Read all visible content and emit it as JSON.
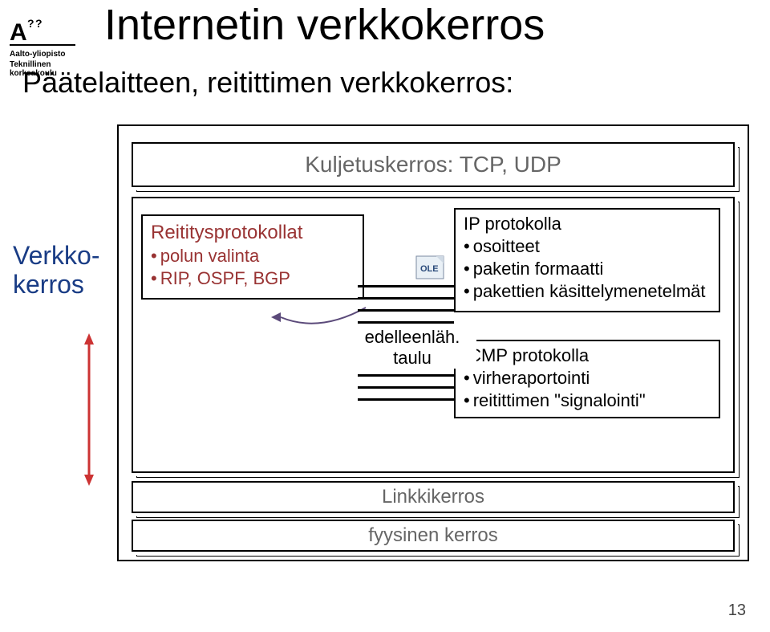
{
  "logo": {
    "line1": "Aalto-yliopisto",
    "line2": "Teknillinen korkeakoulu"
  },
  "title": "Internetin verkkokerros",
  "subtitle": "Päätelaitteen, reitittimen verkkokerros:",
  "sideLabel": {
    "line1": "Verkko-",
    "line2": "kerros"
  },
  "transport": "Kuljetuskerros: TCP, UDP",
  "routing": {
    "title": "Reititysprotokollat",
    "lines": [
      "polun valinta",
      "RIP, OSPF, BGP"
    ]
  },
  "ip": {
    "title": "IP protokolla",
    "lines": [
      "osoitteet",
      "paketin formaatti",
      "pakettien käsittelymenetelmät"
    ]
  },
  "icmp": {
    "title": "ICMP protokolla",
    "lines": [
      "virheraportointi",
      "reitittimen \"signalointi\""
    ]
  },
  "fwd": {
    "line1": "edelleenläh.",
    "line2": "taulu",
    "iconLabel": "OLE"
  },
  "link": "Linkkikerros",
  "phys": "fyysinen kerros",
  "pagenum": "13"
}
